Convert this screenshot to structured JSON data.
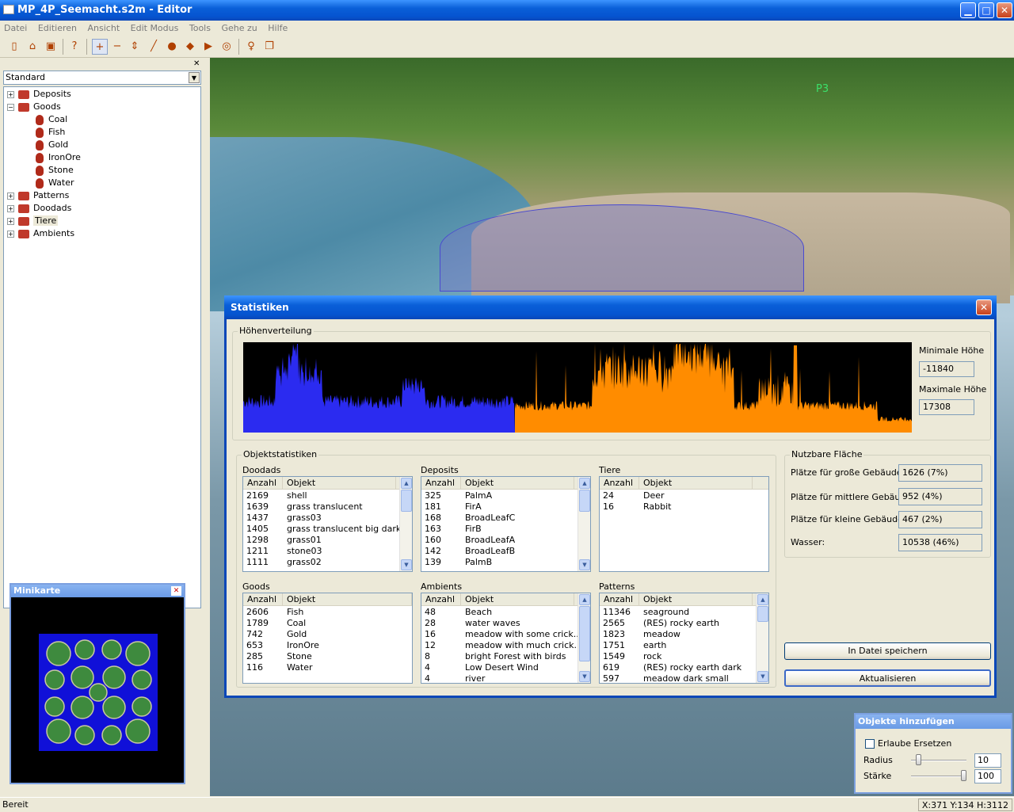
{
  "window": {
    "title": "MP_4P_Seemacht.s2m - Editor",
    "min": "▁",
    "max": "□",
    "close": "✕"
  },
  "menu": [
    "Datei",
    "Editieren",
    "Ansicht",
    "Edit Modus",
    "Tools",
    "Gehe zu",
    "Hilfe"
  ],
  "toolbar": {
    "icons": [
      "new-icon",
      "open-icon",
      "save-icon",
      "help-icon",
      "add-icon",
      "remove-icon",
      "height-icon",
      "brush-icon",
      "paint-icon",
      "fill-icon",
      "play-icon",
      "target-icon",
      "light-icon",
      "copy-icon"
    ]
  },
  "leftpanel": {
    "close": "✕",
    "combo_value": "Standard",
    "combo_arrow": "▼",
    "tree": [
      {
        "label": "Deposits",
        "expander": "+"
      },
      {
        "label": "Goods",
        "expander": "−"
      },
      {
        "label": "Coal"
      },
      {
        "label": "Fish"
      },
      {
        "label": "Gold"
      },
      {
        "label": "IronOre"
      },
      {
        "label": "Stone"
      },
      {
        "label": "Water"
      },
      {
        "label": "Patterns",
        "expander": "+"
      },
      {
        "label": "Doodads",
        "expander": "+"
      },
      {
        "label": "Tiere",
        "expander": "+"
      },
      {
        "label": "Ambients",
        "expander": "+"
      }
    ]
  },
  "minikarte": {
    "title": "Minikarte",
    "close": "✕"
  },
  "viewport": {
    "player_label": "P3"
  },
  "statistiken": {
    "title": "Statistiken",
    "close": "✕",
    "hoehen": {
      "legend": "Höhenverteilung",
      "min_label": "Minimale Höhe",
      "min_value": "-11840",
      "max_label": "Maximale Höhe",
      "max_value": "17308",
      "colors": {
        "low": "#2b2bf0",
        "high": "#ff8c00"
      }
    },
    "objekt_legend": "Objektstatistiken",
    "col_anzahl": "Anzahl",
    "col_objekt": "Objekt",
    "scroll_up": "▲",
    "scroll_down": "▼",
    "lists": {
      "doodads": {
        "title": "Doodads",
        "rows": [
          [
            "2169",
            "shell"
          ],
          [
            "1639",
            "grass translucent"
          ],
          [
            "1437",
            "grass03"
          ],
          [
            "1405",
            "grass translucent big dark"
          ],
          [
            "1298",
            "grass01"
          ],
          [
            "1211",
            "stone03"
          ],
          [
            "1111",
            "grass02"
          ]
        ]
      },
      "deposits": {
        "title": "Deposits",
        "rows": [
          [
            "325",
            "PalmA"
          ],
          [
            "181",
            "FirA"
          ],
          [
            "168",
            "BroadLeafC"
          ],
          [
            "163",
            "FirB"
          ],
          [
            "160",
            "BroadLeafA"
          ],
          [
            "142",
            "BroadLeafB"
          ],
          [
            "139",
            "PalmB"
          ]
        ]
      },
      "tiere": {
        "title": "Tiere",
        "rows": [
          [
            "24",
            "Deer"
          ],
          [
            "16",
            "Rabbit"
          ]
        ]
      },
      "goods": {
        "title": "Goods",
        "rows": [
          [
            "2606",
            "Fish"
          ],
          [
            "1789",
            "Coal"
          ],
          [
            "742",
            "Gold"
          ],
          [
            "653",
            "IronOre"
          ],
          [
            "285",
            "Stone"
          ],
          [
            "116",
            "Water"
          ]
        ]
      },
      "ambients": {
        "title": "Ambients",
        "rows": [
          [
            "48",
            "Beach"
          ],
          [
            "28",
            "water waves"
          ],
          [
            "16",
            "meadow with some crick..."
          ],
          [
            "12",
            "meadow with much crick..."
          ],
          [
            "8",
            "bright Forest with birds"
          ],
          [
            "4",
            "Low Desert Wind"
          ],
          [
            "4",
            "river"
          ]
        ]
      },
      "patterns": {
        "title": "Patterns",
        "rows": [
          [
            "11346",
            "seaground"
          ],
          [
            "2565",
            "(RES) rocky earth"
          ],
          [
            "1823",
            "meadow"
          ],
          [
            "1751",
            "earth"
          ],
          [
            "1549",
            "rock"
          ],
          [
            "619",
            "(RES) rocky earth dark"
          ],
          [
            "597",
            "meadow dark small"
          ]
        ]
      }
    },
    "nutzbar": {
      "legend": "Nutzbare Fläche",
      "rows": [
        {
          "label": "Plätze für große Gebäude:",
          "value": "1626 (7%)"
        },
        {
          "label": "Plätze für mittlere Gebäude:",
          "value": "952 (4%)"
        },
        {
          "label": "Plätze für kleine Gebäude:",
          "value": "467 (2%)"
        },
        {
          "label": "Wasser:",
          "value": "10538 (46%)"
        }
      ]
    },
    "btn_save": "In Datei speichern",
    "btn_refresh": "Aktualisieren"
  },
  "objekte": {
    "title": "Objekte hinzufügen",
    "checkbox_label": "Erlaube Ersetzen",
    "checkbox_checked": false,
    "radius_label": "Radius",
    "radius_value": "10",
    "radius_fraction": 0.1,
    "staerke_label": "Stärke",
    "staerke_value": "100",
    "staerke_fraction": 1.0
  },
  "status": {
    "text": "Bereit",
    "coords": "X:371 Y:134 H:3112"
  }
}
